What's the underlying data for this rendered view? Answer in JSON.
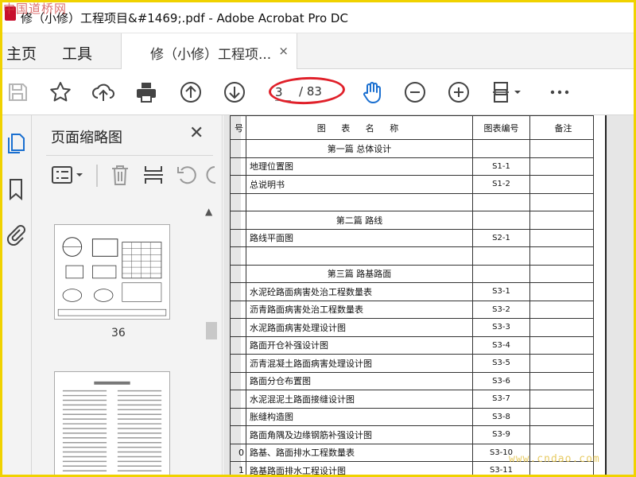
{
  "watermark_top": "中国道桥网",
  "watermark_bottom": "www.cndao.com",
  "window": {
    "title": "修（小修）工程项目&#1469;.pdf - Adobe Acrobat Pro DC"
  },
  "menu": {
    "home": "主页",
    "tools": "工具"
  },
  "tab": {
    "label": "修（小修）工程项...",
    "close": "×"
  },
  "toolbar": {
    "page_current": "3",
    "page_total": "/ 83",
    "highlight_color": "#e0202a"
  },
  "panel": {
    "title": "页面缩略图",
    "close": "✕",
    "thumbnails": [
      {
        "label": "36"
      },
      {
        "label": ""
      }
    ]
  },
  "document": {
    "header": {
      "no": "号",
      "name": "图 表 名 称",
      "code": "图表编号",
      "note": "备注"
    },
    "rows": [
      {
        "type": "section",
        "no": "",
        "name": "第一篇 总体设计",
        "code": ""
      },
      {
        "type": "item",
        "no": "",
        "name": "地理位置图",
        "code": "S1-1"
      },
      {
        "type": "item",
        "no": "",
        "name": "总说明书",
        "code": "S1-2"
      },
      {
        "type": "blank",
        "no": "",
        "name": "",
        "code": ""
      },
      {
        "type": "section",
        "no": "",
        "name": "第二篇 路线",
        "code": ""
      },
      {
        "type": "item",
        "no": "",
        "name": "路线平面图",
        "code": "S2-1"
      },
      {
        "type": "blank",
        "no": "",
        "name": "",
        "code": ""
      },
      {
        "type": "section",
        "no": "",
        "name": "第三篇 路基路面",
        "code": ""
      },
      {
        "type": "item",
        "no": "",
        "name": "水泥砼路面病害处治工程数量表",
        "code": "S3-1"
      },
      {
        "type": "item",
        "no": "",
        "name": "沥青路面病害处治工程数量表",
        "code": "S3-2"
      },
      {
        "type": "item",
        "no": "",
        "name": "水泥路面病害处理设计图",
        "code": "S3-3"
      },
      {
        "type": "item",
        "no": "",
        "name": "路面开仓补强设计图",
        "code": "S3-4"
      },
      {
        "type": "item",
        "no": "",
        "name": "沥青混凝土路面病害处理设计图",
        "code": "S3-5"
      },
      {
        "type": "item",
        "no": "",
        "name": "路面分仓布置图",
        "code": "S3-6"
      },
      {
        "type": "item",
        "no": "",
        "name": "水泥混泥土路面接缝设计图",
        "code": "S3-7"
      },
      {
        "type": "item",
        "no": "",
        "name": "胀缝构造图",
        "code": "S3-8"
      },
      {
        "type": "item",
        "no": "",
        "name": "路面角隅及边缘钢筋补强设计图",
        "code": "S3-9"
      },
      {
        "type": "item",
        "no": "0",
        "name": "路基、路面排水工程数量表",
        "code": "S3-10"
      },
      {
        "type": "item",
        "no": "1",
        "name": "路基路面排水工程设计图",
        "code": "S3-11"
      }
    ]
  }
}
